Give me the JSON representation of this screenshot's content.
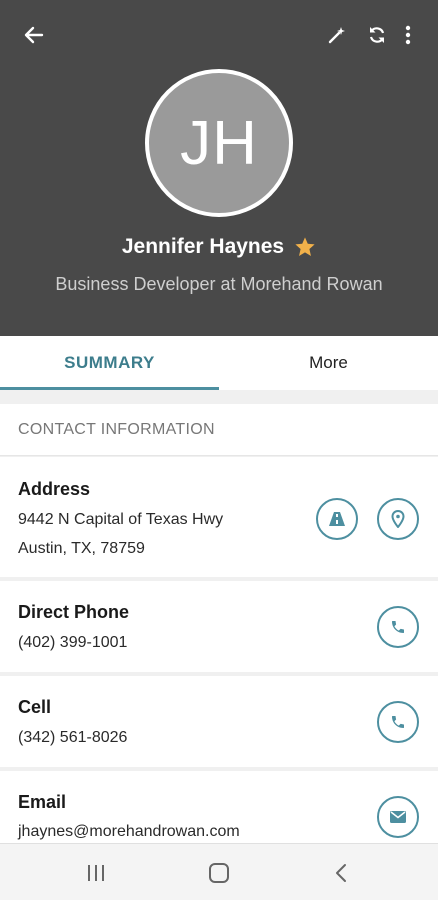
{
  "header": {
    "avatar_initials": "JH",
    "name": "Jennifer Haynes",
    "subtitle": "Business Developer at Morehand Rowan",
    "bg_color": "#494949",
    "favorite_star_color": "#f2b14a"
  },
  "icons": {
    "back": "arrow-left-icon",
    "magic": "magic-wand-icon",
    "sync": "sync-icon",
    "more": "more-vert-icon",
    "star": "star-icon"
  },
  "tabs": [
    {
      "label": "SUMMARY",
      "active": true
    },
    {
      "label": "More",
      "active": false
    }
  ],
  "contact": {
    "section_title": "CONTACT INFORMATION",
    "address": {
      "label": "Address",
      "line1": "9442 N Capital of Texas Hwy",
      "line2": "Austin, TX, 78759"
    },
    "direct_phone": {
      "label": "Direct Phone",
      "value": "(402) 399-1001"
    },
    "cell": {
      "label": "Cell",
      "value": "(342) 561-8026"
    },
    "email": {
      "label": "Email",
      "value": "jhaynes@morehandrowan.com"
    }
  },
  "accent_color": "#4d8fa0"
}
